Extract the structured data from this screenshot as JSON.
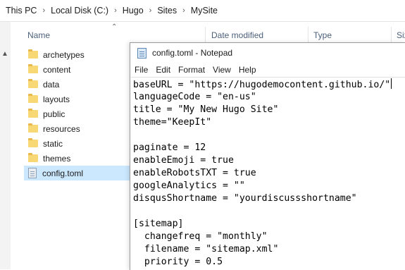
{
  "breadcrumb": [
    "This PC",
    "Local Disk (C:)",
    "Hugo",
    "Sites",
    "MySite"
  ],
  "columns": {
    "name": "Name",
    "date_modified": "Date modified",
    "type": "Type",
    "size": "Siz"
  },
  "files": [
    {
      "name": "archetypes",
      "icon": "folder-icon"
    },
    {
      "name": "content",
      "icon": "folder-icon"
    },
    {
      "name": "data",
      "icon": "folder-icon"
    },
    {
      "name": "layouts",
      "icon": "folder-icon"
    },
    {
      "name": "public",
      "icon": "folder-icon"
    },
    {
      "name": "resources",
      "icon": "folder-icon"
    },
    {
      "name": "static",
      "icon": "folder-icon"
    },
    {
      "name": "themes",
      "icon": "folder-icon"
    },
    {
      "name": "config.toml",
      "icon": "file-icon",
      "selected": true
    }
  ],
  "notepad": {
    "title": "config.toml - Notepad",
    "menu": [
      "File",
      "Edit",
      "Format",
      "View",
      "Help"
    ],
    "lines": [
      "baseURL = \"https://hugodemocontent.github.io/\"",
      "languageCode = \"en-us\"",
      "title = \"My New Hugo Site\"",
      "theme=\"KeepIt\"",
      "",
      "paginate = 12",
      "enableEmoji = true",
      "enableRobotsTXT = true",
      "googleAnalytics = \"\"",
      "disqusShortname = \"yourdiscussshortname\"",
      "",
      "[sitemap]",
      "  changefreq = \"monthly\"",
      "  filename = \"sitemap.xml\"",
      "  priority = 0.5"
    ]
  },
  "colors": {
    "selection": "#cce8ff",
    "folder": "#f8d775",
    "header_text": "#4c607a"
  }
}
